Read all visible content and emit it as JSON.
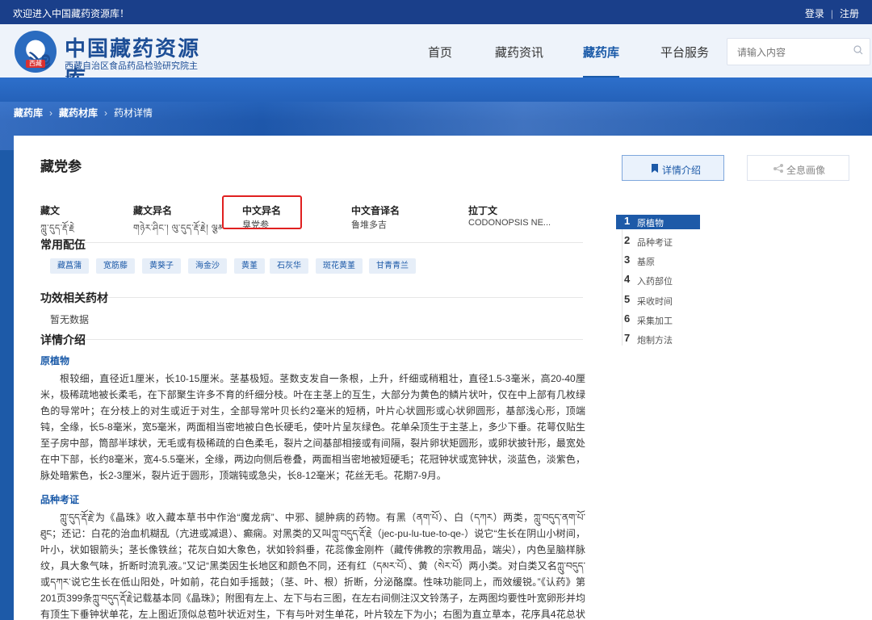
{
  "topbar": {
    "welcome": "欢迎进入中国藏药资源库！",
    "login": "登录",
    "register": "注册"
  },
  "header": {
    "logo_title": "中国藏药资源库",
    "logo_subtitle": "西藏自治区食品药品检验研究院主办",
    "logo_badge": "西藏",
    "nav": [
      {
        "label": "首页"
      },
      {
        "label": "藏药资讯"
      },
      {
        "label": "藏药库"
      },
      {
        "label": "平台服务"
      }
    ],
    "search_placeholder": "请输入内容"
  },
  "breadcrumb": {
    "level1": "藏药库",
    "level2": "藏药材库",
    "current": "药材详情"
  },
  "detail": {
    "title": "藏党参",
    "btn_detail": "详情介绍",
    "btn_portrait": "全息画像",
    "names": [
      {
        "label": "藏文",
        "value": "ཀླུ་དུད་རྡོ་རྗེ"
      },
      {
        "label": "藏文异名",
        "value": "གཉེར་ཤིང་། ལུ་དུད་རྡོ་རྗེ། ལྕམ་..."
      },
      {
        "label": "中文异名",
        "value": "臭党参"
      },
      {
        "label": "中文音译名",
        "value": "鲁堆多吉"
      },
      {
        "label": "拉丁文",
        "value": "CODONOPSIS NE..."
      }
    ],
    "section_pairing": "常用配伍",
    "tags": [
      "藏菖蒲",
      "宽筋藤",
      "黄葵子",
      "海金沙",
      "黄堇",
      "石灰华",
      "斑花黄堇",
      "甘青青兰"
    ],
    "section_related": "功效相关药材",
    "no_data": "暂无数据",
    "section_detail": "详情介绍",
    "sub_origin": "原植物",
    "para_origin": "根较细，直径近1厘米，长10-15厘米。茎基极短。茎数支发自一条根，上升，纤细或稍粗壮，直径1.5-3毫米，高20-40厘米，极稀疏地被长柔毛，在下部聚生许多不育的纤细分枝。叶在主茎上的互生，大部分为黄色的鳞片状叶，仅在中上部有几枚绿色的导常叶；在分枝上的对生或近于对生，全部导常叶贝长约2毫米的短柄，叶片心状圆形或心状卵圆形，基部浅心形，顶端钝，全缘，长5-8毫米，宽5毫米，两面相当密地被白色长硬毛，使叶片呈灰绿色。花单朵顶生于主茎上，多少下垂。花萼仅贴生至子房中部，筒部半球状，无毛或有极稀疏的白色柔毛，裂片之间基部相接或有间隔，裂片卵状矩圆形，或卵状披针形，最宽处在中下部，长约8毫米，宽4-5.5毫米，全缘，两边向侧后卷叠，两面相当密地被短硬毛；花冠钟状或宽钟状，淡蓝色，淡紫色，脉处暗紫色，长2-3厘米，裂片近于圆形，顶端钝或急尖，长8-12毫米；花丝无毛。花期7-9月。",
    "sub_variety": "品种考证",
    "para_variety": "ཀླུ་དུད་རྡོ་རྗེ་为《晶珠》收入藏本草书中作治“魔龙病”、中邪、腿肿病的药物。有黑（ནག་པོ）、白（དཀར）两类，ཀླུ་བདུད་ནག་པོ་ཐུང；还记：白花的治血机糊乱（亢进或减退）、癫痫。对黑类的又叫ཀླུ་བདུད་རྡོ་རྗེ（jec-pu-lu-tue-to-qe-）说它“生长在阴山小树间，叶小，状如银箭头；茎长像铁丝；花灰白如大象色，状如铃斜垂，花蕊像金刚杵（藏传佛教的宗教用品，端尖），内色呈脑样脉纹，具大象气味，折断时流乳液。”又记“黑类因生长地区和颜色不同，还有红（དམར་པོ）、黄（སེར་པོ）两小类。对白类又名ཀླུ་བདུད་或དཀར་说它生长在低山阳处，叶如前，花白如手摇鼓；（茎、叶、根）折断，分泌酪糜。性味功能同上，而效缓锐。”《认药》第201页399条ཀླུ་བདུད་རྡོ་རྗེ记载基本同《晶珠》；附图有左上、左下与右三图，在左右间侧注汉文铃荡子，左两图均要性叶宽卵形并均有顶生下垂钟状单花，左上图近顶似总苞叶状近对生，下有与叶对生单花，叶片较左下为小；右图为直立草本，花序具4花总状排列，花下垂钟状，叶近",
    "toc": [
      {
        "num": "1",
        "label": "原植物"
      },
      {
        "num": "2",
        "label": "品种考证"
      },
      {
        "num": "3",
        "label": "基原"
      },
      {
        "num": "4",
        "label": "入药部位"
      },
      {
        "num": "5",
        "label": "采收时间"
      },
      {
        "num": "6",
        "label": "采集加工"
      },
      {
        "num": "7",
        "label": "炮制方法"
      }
    ]
  },
  "colors": {
    "brand_blue": "#1d5aa8",
    "topbar": "#1a3f8a",
    "highlight_red": "#e02020"
  },
  "icons": {
    "search": "search-icon",
    "detail": "bookmark-icon",
    "portrait": "share-icon"
  }
}
